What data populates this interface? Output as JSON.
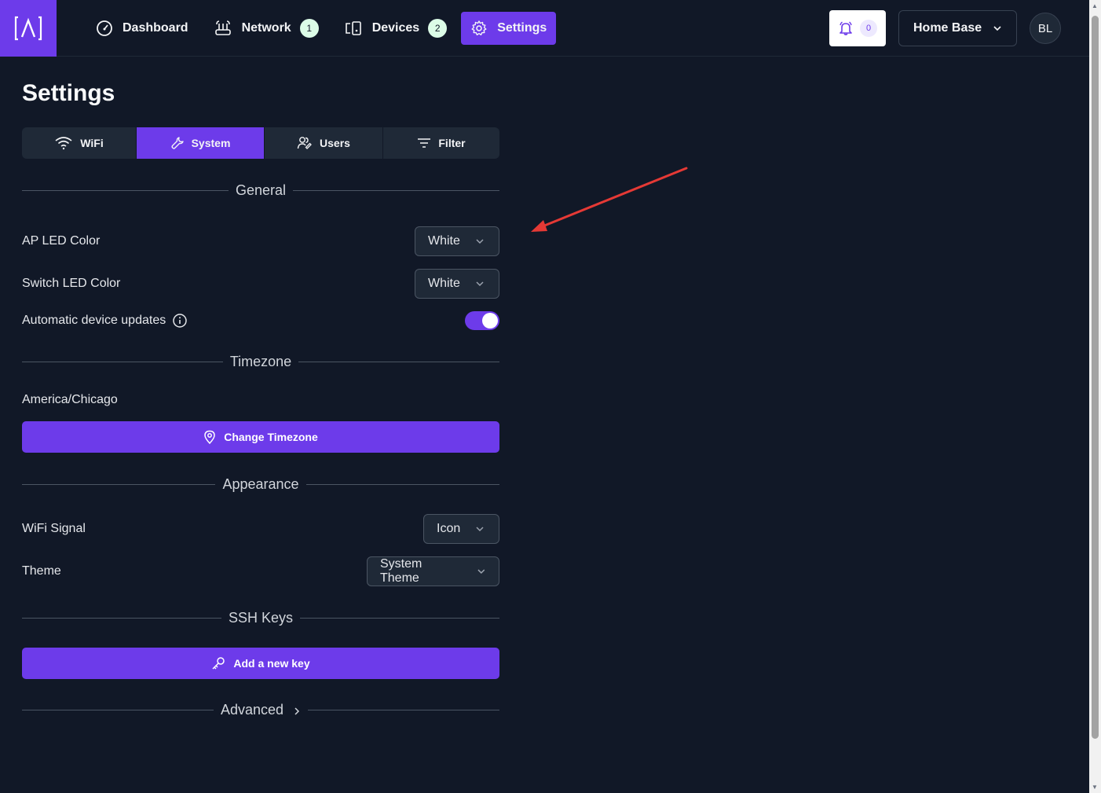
{
  "nav": {
    "items": [
      {
        "label": "Dashboard",
        "icon": "gauge-icon"
      },
      {
        "label": "Network",
        "icon": "router-icon",
        "badge": "1"
      },
      {
        "label": "Devices",
        "icon": "devices-icon",
        "badge": "2"
      },
      {
        "label": "Settings",
        "icon": "gear-icon",
        "active": true
      }
    ]
  },
  "header": {
    "notifications_count": "0",
    "site_name": "Home Base",
    "avatar_initials": "BL"
  },
  "page": {
    "title": "Settings",
    "tabs": [
      {
        "label": "WiFi",
        "icon": "wifi-icon"
      },
      {
        "label": "System",
        "icon": "wrench-icon",
        "active": true
      },
      {
        "label": "Users",
        "icon": "users-icon"
      },
      {
        "label": "Filter",
        "icon": "filter-icon"
      }
    ]
  },
  "general": {
    "heading": "General",
    "ap_led_label": "AP LED Color",
    "ap_led_value": "White",
    "switch_led_label": "Switch LED Color",
    "switch_led_value": "White",
    "auto_updates_label": "Automatic device updates",
    "auto_updates_enabled": true
  },
  "timezone": {
    "heading": "Timezone",
    "value": "America/Chicago",
    "button_label": "Change Timezone"
  },
  "appearance": {
    "heading": "Appearance",
    "wifi_signal_label": "WiFi Signal",
    "wifi_signal_value": "Icon",
    "theme_label": "Theme",
    "theme_value": "System Theme"
  },
  "ssh": {
    "heading": "SSH Keys",
    "button_label": "Add a new key"
  },
  "advanced": {
    "heading": "Advanced"
  },
  "colors": {
    "accent": "#6d3bea",
    "background": "#111827",
    "annotation_arrow": "#e53935"
  }
}
